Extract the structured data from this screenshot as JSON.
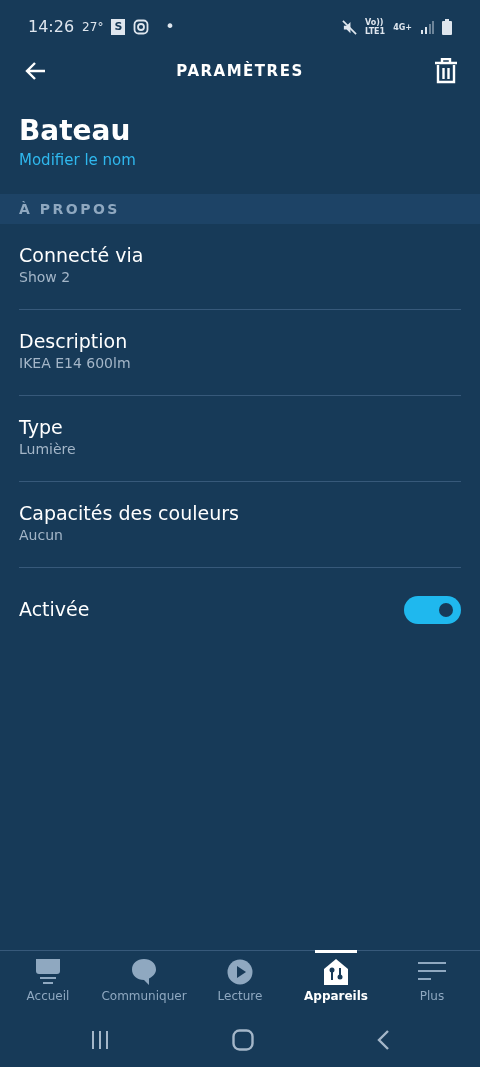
{
  "status_bar": {
    "time": "14:26",
    "temperature": "27°",
    "app_badge": "S",
    "dot": "•",
    "volte": "Vo))",
    "lte": "LTE1",
    "network": "4G+"
  },
  "header": {
    "title": "PARAMÈTRES"
  },
  "device": {
    "name": "Bateau",
    "rename_link": "Modifier le nom"
  },
  "section": {
    "title": "À PROPOS"
  },
  "rows": [
    {
      "label": "Connecté via",
      "value": "Show 2"
    },
    {
      "label": "Description",
      "value": "IKEA E14 600lm"
    },
    {
      "label": "Type",
      "value": "Lumière"
    },
    {
      "label": "Capacités des couleurs",
      "value": "Aucun"
    }
  ],
  "toggle": {
    "label": "Activée",
    "on": true
  },
  "bottom_nav": [
    {
      "label": "Accueil",
      "selected": false
    },
    {
      "label": "Communiquer",
      "selected": false
    },
    {
      "label": "Lecture",
      "selected": false
    },
    {
      "label": "Appareils",
      "selected": true
    },
    {
      "label": "Plus",
      "selected": false
    }
  ]
}
